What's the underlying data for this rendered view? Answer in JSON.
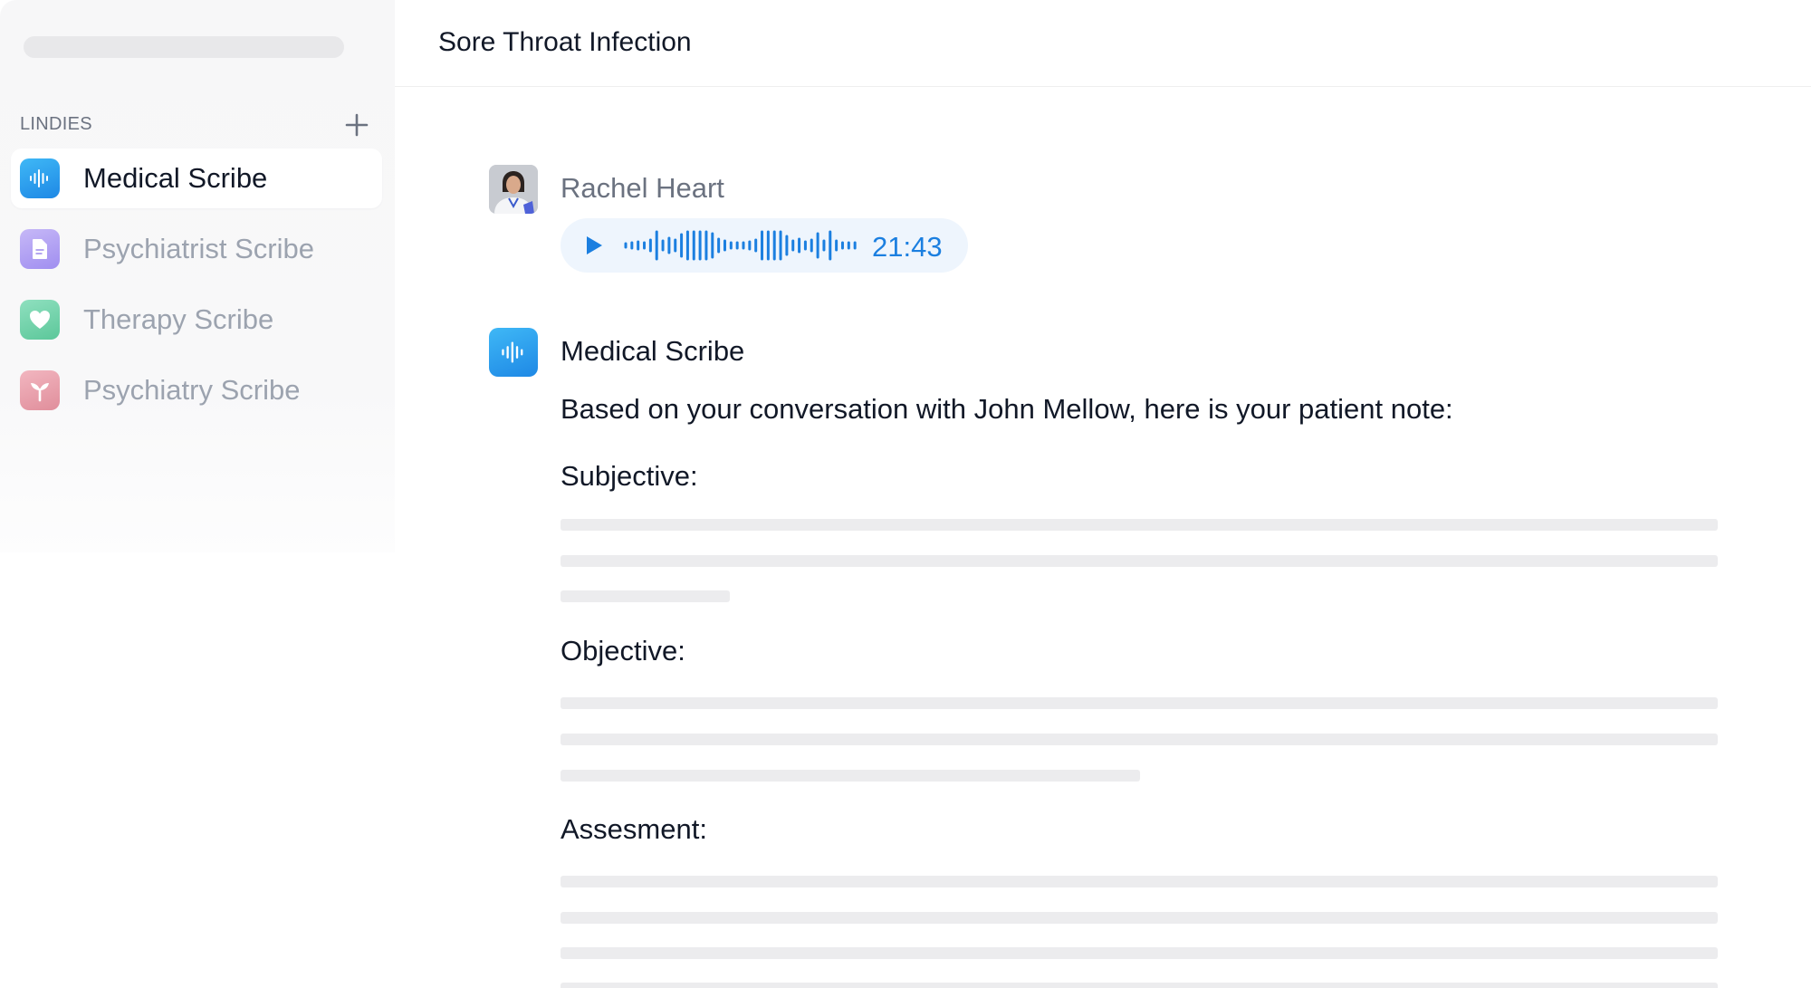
{
  "sidebar": {
    "section_label": "LINDIES",
    "items": [
      {
        "label": "Medical Scribe",
        "icon": "waveform-icon",
        "color": "#2196f3",
        "active": true
      },
      {
        "label": "Psychiatrist Scribe",
        "icon": "document-icon",
        "color": "#b4a6f0",
        "active": false
      },
      {
        "label": "Therapy Scribe",
        "icon": "heart-icon",
        "color": "#7dd3b0",
        "active": false
      },
      {
        "label": "Psychiatry Scribe",
        "icon": "sprout-icon",
        "color": "#eba3ae",
        "active": false
      }
    ]
  },
  "header": {
    "title": "Sore Throat Infection"
  },
  "thread": {
    "user_message": {
      "sender": "Rachel Heart",
      "audio_duration": "21:43"
    },
    "bot_message": {
      "sender": "Medical Scribe",
      "intro": "Based on your conversation with John Mellow, here is your patient note:",
      "sections": [
        {
          "title": "Subjective:"
        },
        {
          "title": "Objective:"
        },
        {
          "title": "Assesment:"
        }
      ]
    }
  },
  "colors": {
    "accent": "#1b7fe0",
    "audio_bg": "#eef5fd",
    "skeleton": "#ececee"
  }
}
